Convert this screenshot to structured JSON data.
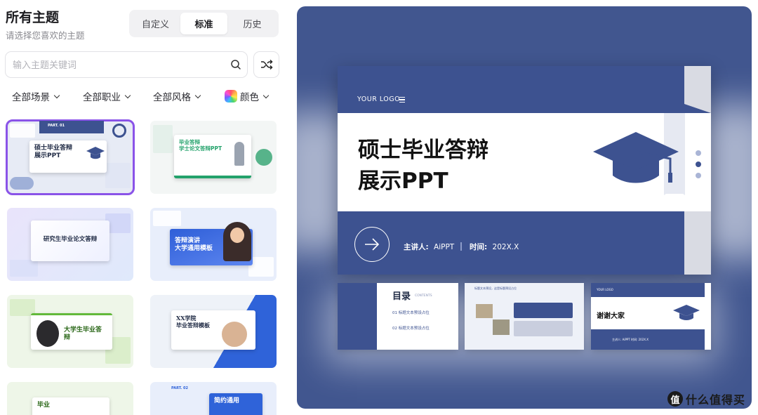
{
  "header": {
    "title": "所有主题",
    "subtitle": "请选择您喜欢的主题"
  },
  "tabs": [
    {
      "label": "自定义",
      "active": false
    },
    {
      "label": "标准",
      "active": true
    },
    {
      "label": "历史",
      "active": false
    }
  ],
  "search": {
    "placeholder": "输入主题关键词",
    "value": "",
    "icon": "search-icon"
  },
  "shuffle": {
    "icon": "shuffle-icon"
  },
  "filters": [
    {
      "label": "全部场景"
    },
    {
      "label": "全部职业"
    },
    {
      "label": "全部风格"
    },
    {
      "label": "颜色",
      "icon": "color-swatch-icon"
    }
  ],
  "templates": [
    {
      "title": "硕士毕业答辩\n展示PPT",
      "header": "PART. 01",
      "selected": true,
      "accent": "#3d5290"
    },
    {
      "title": "毕业答辩\n学士论文答辩PPT",
      "selected": false,
      "accent": "#23a26b"
    },
    {
      "title": "研究生毕业论文答辩",
      "selected": false,
      "accent": "#7c7fe6"
    },
    {
      "title": "答辩演讲\n大学通用模板",
      "selected": false,
      "accent": "#2f5fd8"
    },
    {
      "title": "大学生毕业答辩",
      "selected": false,
      "accent": "#63b93b"
    },
    {
      "title": "XX学院\n毕业答辩模板",
      "selected": false,
      "accent": "#2f63d9"
    },
    {
      "title": "毕业",
      "selected": false,
      "accent": "#63b93b"
    },
    {
      "title": "简约通用",
      "header": "PART. 02",
      "selected": false,
      "accent": "#2f63d9"
    }
  ],
  "preview": {
    "logo": "YOUR LOGO",
    "title": "硕士毕业答辩\n展示PPT",
    "presenter_label": "主讲人:",
    "presenter": "AiPPT",
    "time_label": "时间:",
    "time": "202X.X",
    "icon": "graduation-cap-icon",
    "accent": "#3d5290"
  },
  "mini_slides": [
    {
      "heading": "目录",
      "sub": "CONTENTS",
      "items": [
        "01 标题文本预设占位",
        "02 标题文本预设占位"
      ]
    },
    {
      "heading": "标题文本预设，这是标题预设占位"
    },
    {
      "heading": "谢谢大家",
      "logo": "YOUR LOGO",
      "footer": "主讲人: AiPPT    时间: 202X.X"
    }
  ],
  "watermark": {
    "text": "什么值得买",
    "badge": "值"
  }
}
